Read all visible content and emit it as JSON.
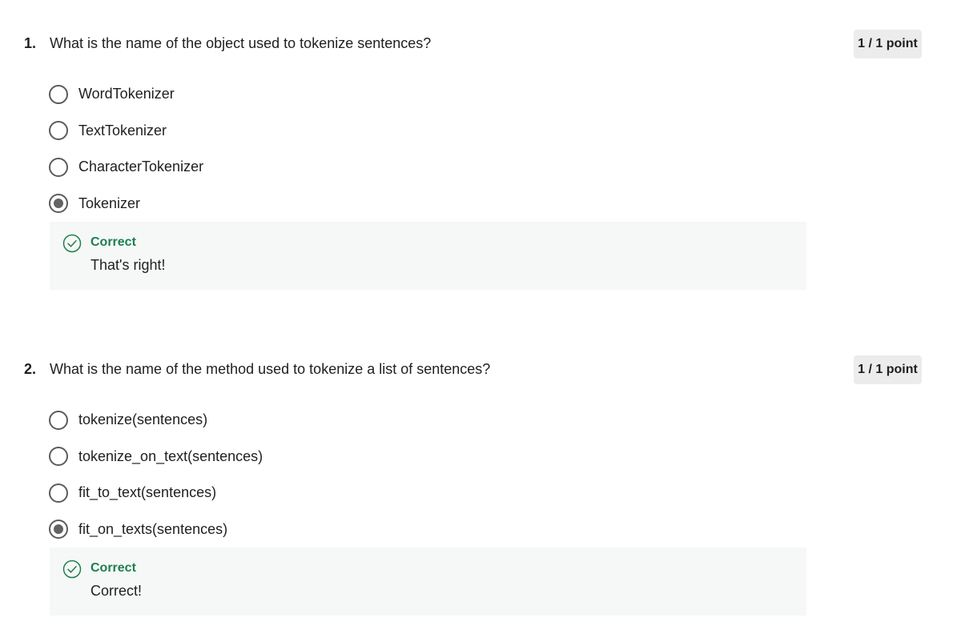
{
  "questions": [
    {
      "number": "1.",
      "text": "What is the name of the object used to tokenize sentences?",
      "points": "1 / 1 point",
      "options": [
        {
          "label": "WordTokenizer",
          "selected": false
        },
        {
          "label": "TextTokenizer",
          "selected": false
        },
        {
          "label": "CharacterTokenizer",
          "selected": false
        },
        {
          "label": "Tokenizer",
          "selected": true
        }
      ],
      "feedback": {
        "title": "Correct",
        "text": "That's right!",
        "icon": "check-circle-icon"
      }
    },
    {
      "number": "2.",
      "text": "What is the name of the method used to tokenize a list of sentences?",
      "points": "1 / 1 point",
      "options": [
        {
          "label": "tokenize(sentences)",
          "selected": false
        },
        {
          "label": "tokenize_on_text(sentences)",
          "selected": false
        },
        {
          "label": "fit_to_text(sentences)",
          "selected": false
        },
        {
          "label": "fit_on_texts(sentences)",
          "selected": true
        }
      ],
      "feedback": {
        "title": "Correct",
        "text": "Correct!",
        "icon": "check-circle-icon"
      }
    }
  ],
  "colors": {
    "correct_green": "#1f7e4f",
    "feedback_bg": "#f5f8f7",
    "points_bg": "#ececec",
    "radio_border": "#5b5b5b"
  }
}
